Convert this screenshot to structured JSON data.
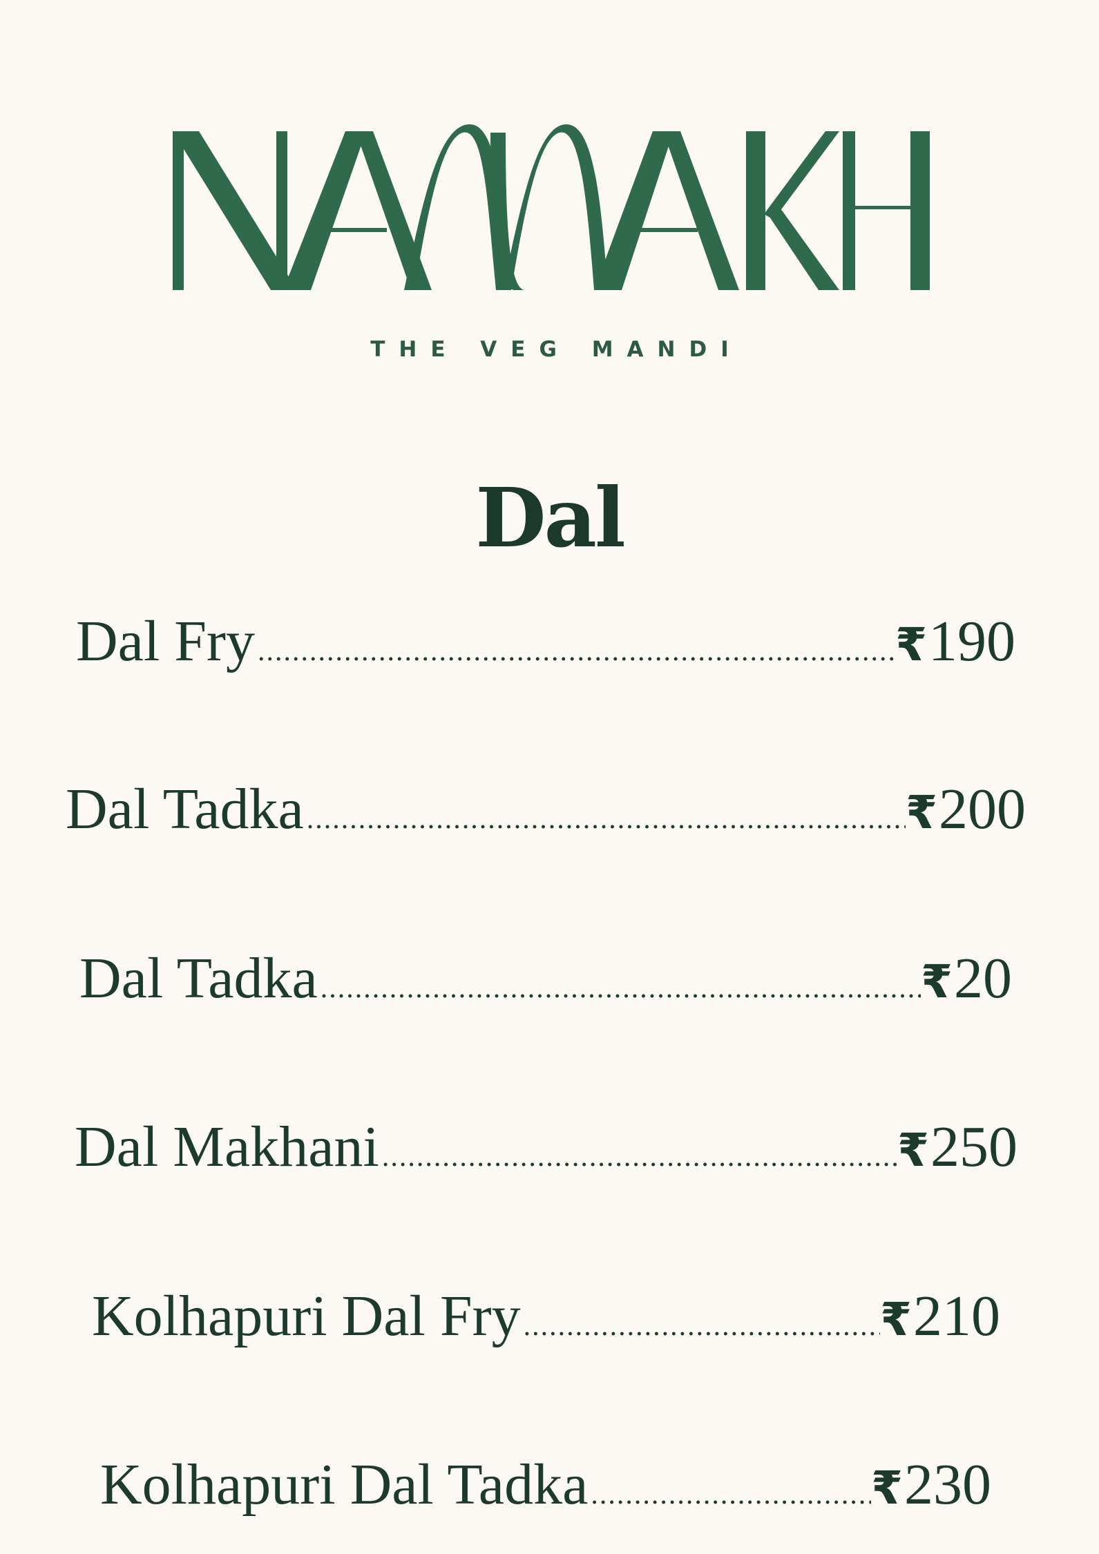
{
  "brand": {
    "logo_text": "NAMAKH",
    "tagline": "THE VEG MANDI",
    "color": "#2e6a4b"
  },
  "section": {
    "title": "Dal"
  },
  "currency_symbol": "₹",
  "items": [
    {
      "name": "Dal Fry",
      "price": "190"
    },
    {
      "name": "Dal Tadka",
      "price": "200"
    },
    {
      "name": "Dal Tadka",
      "price": "20"
    },
    {
      "name": "Dal Makhani",
      "price": "250"
    },
    {
      "name": "Kolhapuri Dal Fry",
      "price": "210"
    },
    {
      "name": "Kolhapuri Dal Tadka",
      "price": "230"
    }
  ]
}
